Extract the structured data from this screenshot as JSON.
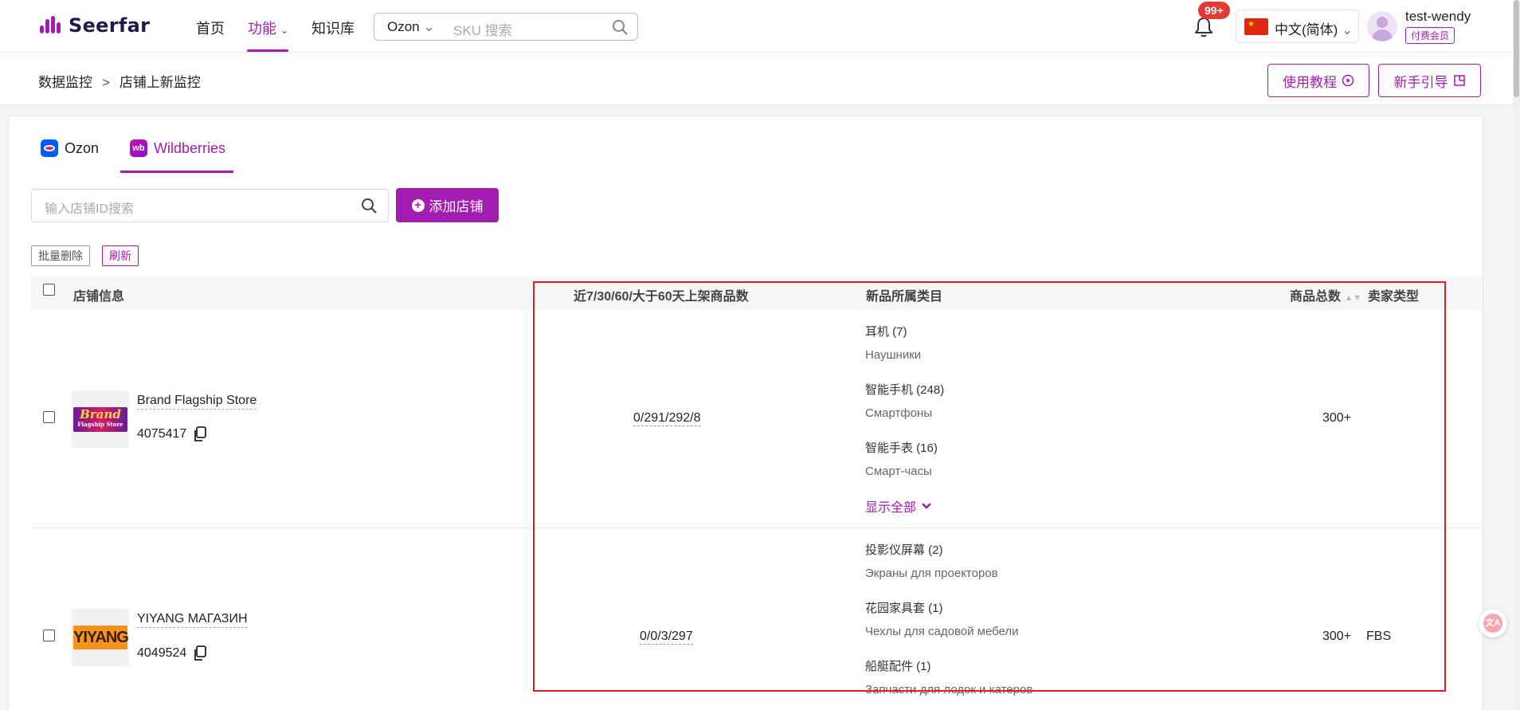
{
  "header": {
    "logo_text": "Seerfar",
    "nav": {
      "home": "首页",
      "features": "功能",
      "knowledge": "知识库"
    },
    "search": {
      "platform": "Ozon",
      "placeholder": "SKU 搜索"
    },
    "notifications_badge": "99+",
    "language": "中文(简体)",
    "user": {
      "name": "test-wendy",
      "tier": "付费会员"
    }
  },
  "breadcrumb": {
    "parent": "数据监控",
    "separator": ">",
    "current": "店铺上新监控"
  },
  "actions": {
    "tutorial": "使用教程",
    "guide": "新手引导"
  },
  "tabs": [
    {
      "label": "Ozon",
      "active": false
    },
    {
      "label": "Wildberries",
      "active": true
    }
  ],
  "toolbar": {
    "shop_search_placeholder": "输入店铺ID搜索",
    "add_shop": "添加店铺",
    "batch_delete": "批量删除",
    "refresh": "刷新"
  },
  "table": {
    "headers": {
      "shop_info": "店铺信息",
      "listing_counts": "近7/30/60/大于60天上架商品数",
      "categories": "新品所属类目",
      "total": "商品总数",
      "seller_type": "卖家类型"
    },
    "rows": [
      {
        "logo_text": "Brand",
        "logo_subtext": "Flagship Store",
        "name": "Brand Flagship Store",
        "id": "4075417",
        "counts": "0/291/292/8",
        "categories": [
          {
            "zh": "耳机 (7)",
            "ru": "Наушники"
          },
          {
            "zh": "智能手机 (248)",
            "ru": "Смартфоны"
          },
          {
            "zh": "智能手表 (16)",
            "ru": "Смарт-часы"
          }
        ],
        "show_all": "显示全部",
        "total": "300+",
        "seller_type": ""
      },
      {
        "logo_text": "YIYANG",
        "name": "YIYANG МАГАЗИН",
        "id": "4049524",
        "counts": "0/0/3/297",
        "categories": [
          {
            "zh": "投影仪屏幕 (2)",
            "ru": "Экраны для проекторов"
          },
          {
            "zh": "花园家具套 (1)",
            "ru": "Чехлы для садовой мебели"
          },
          {
            "zh": "船艇配件 (1)",
            "ru": "Запчасти для лодок и катеров"
          }
        ],
        "total": "300+",
        "seller_type": "FBS"
      }
    ]
  },
  "colors": {
    "accent": "#a21caf",
    "highlight_box": "#e02020"
  }
}
